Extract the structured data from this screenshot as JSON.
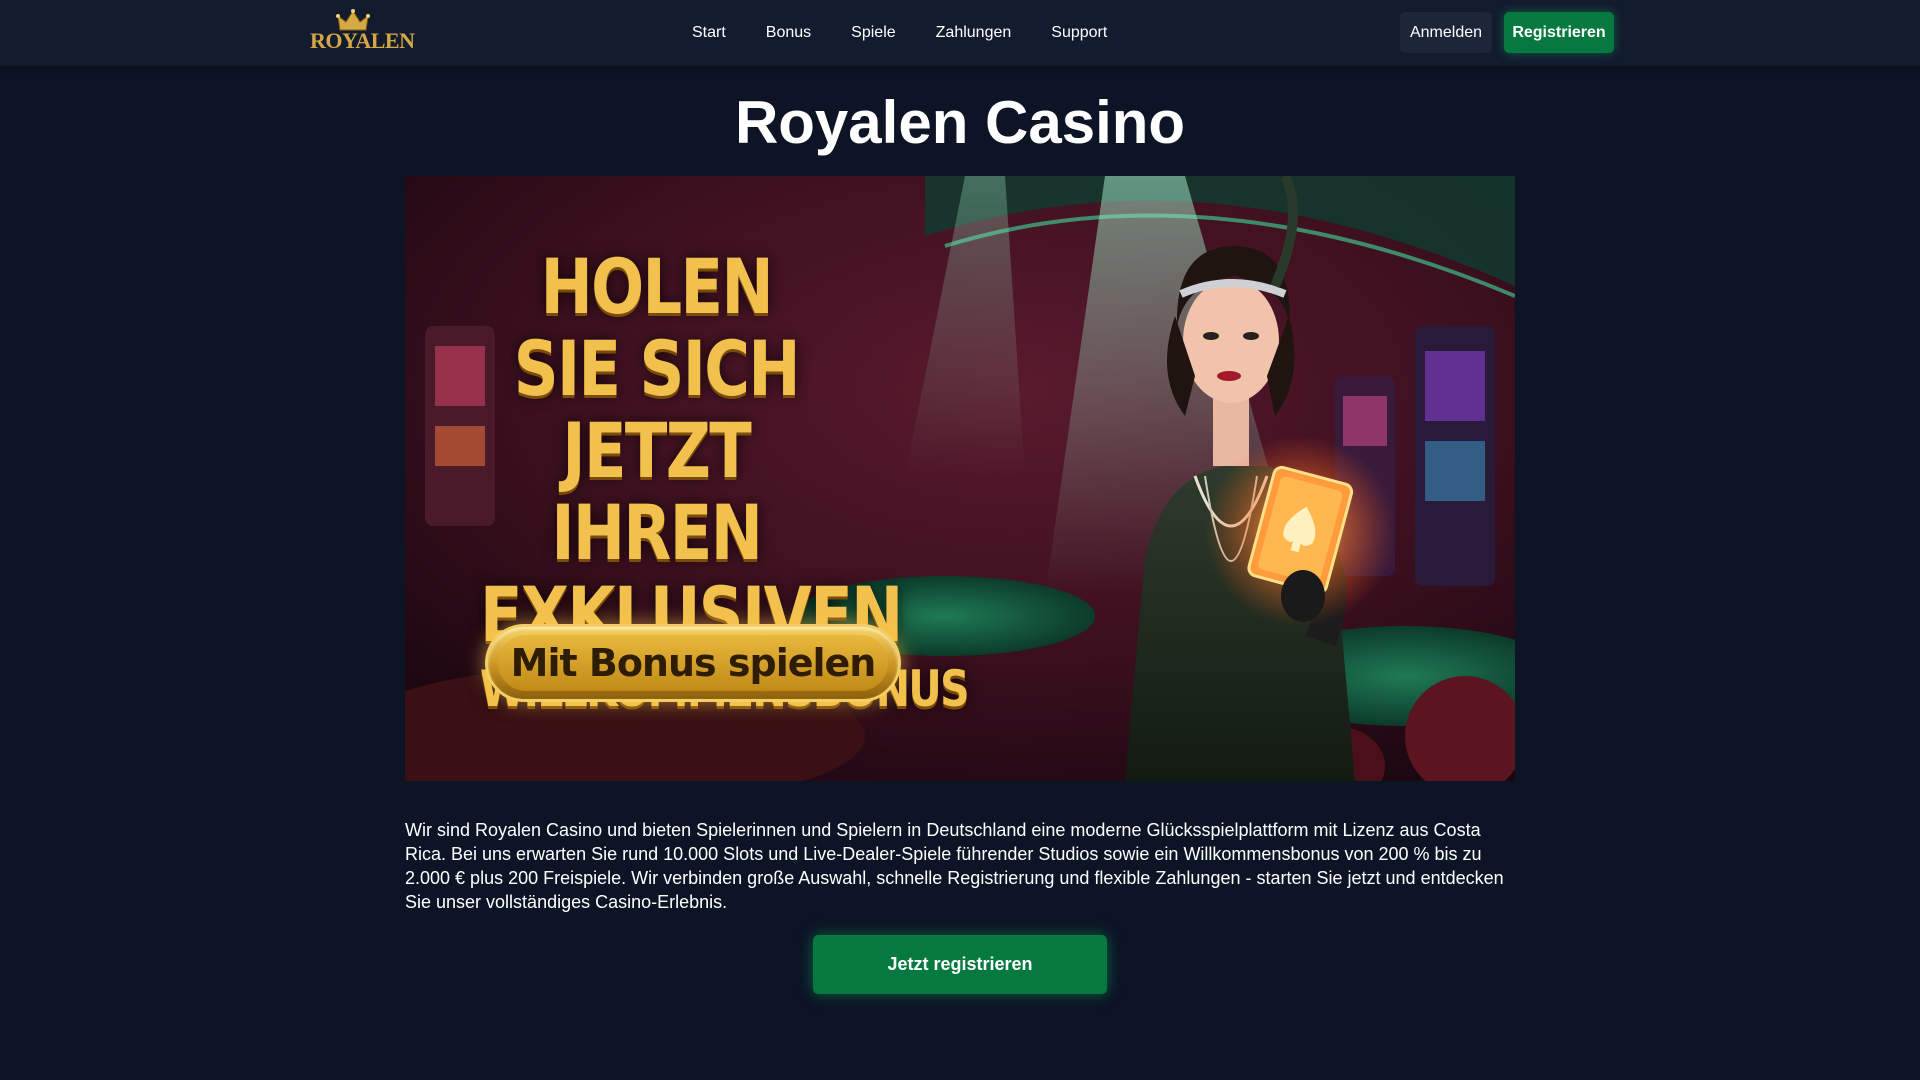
{
  "colors": {
    "background": "#0d1426",
    "navbar": "#131b2e",
    "accent_green": "#05793f",
    "gold": "#d4a843"
  },
  "header": {
    "logo_text": "ROYALEN",
    "nav": [
      {
        "label": "Start"
      },
      {
        "label": "Bonus"
      },
      {
        "label": "Spiele"
      },
      {
        "label": "Zahlungen"
      },
      {
        "label": "Support"
      }
    ],
    "login_label": "Anmelden",
    "register_label": "Registrieren"
  },
  "main": {
    "title": "Royalen Casino",
    "banner": {
      "headline_1": "HOLEN SIE SICH",
      "headline_2": "JETZT IHREN",
      "headline_3": "EXKLUSIVEN",
      "headline_4": "WILLKOMMENSBONUS",
      "cta_label": "Mit Bonus spielen"
    },
    "intro": "Wir sind Royalen Casino und bieten Spielerinnen und Spielern in Deutschland eine moderne Glücksspielplattform mit Lizenz aus Costa Rica. Bei uns erwarten Sie rund 10.000 Slots und Live-Dealer-Spiele führender Studios sowie ein Willkommensbonus von 200 % bis zu 2.000 € plus 200 Freispiele. Wir verbinden große Auswahl, schnelle Registrierung und flexible Zahlungen - starten Sie jetzt und entdecken Sie unser vollständiges Casino-Erlebnis.",
    "cta_label": "Jetzt registrieren"
  }
}
